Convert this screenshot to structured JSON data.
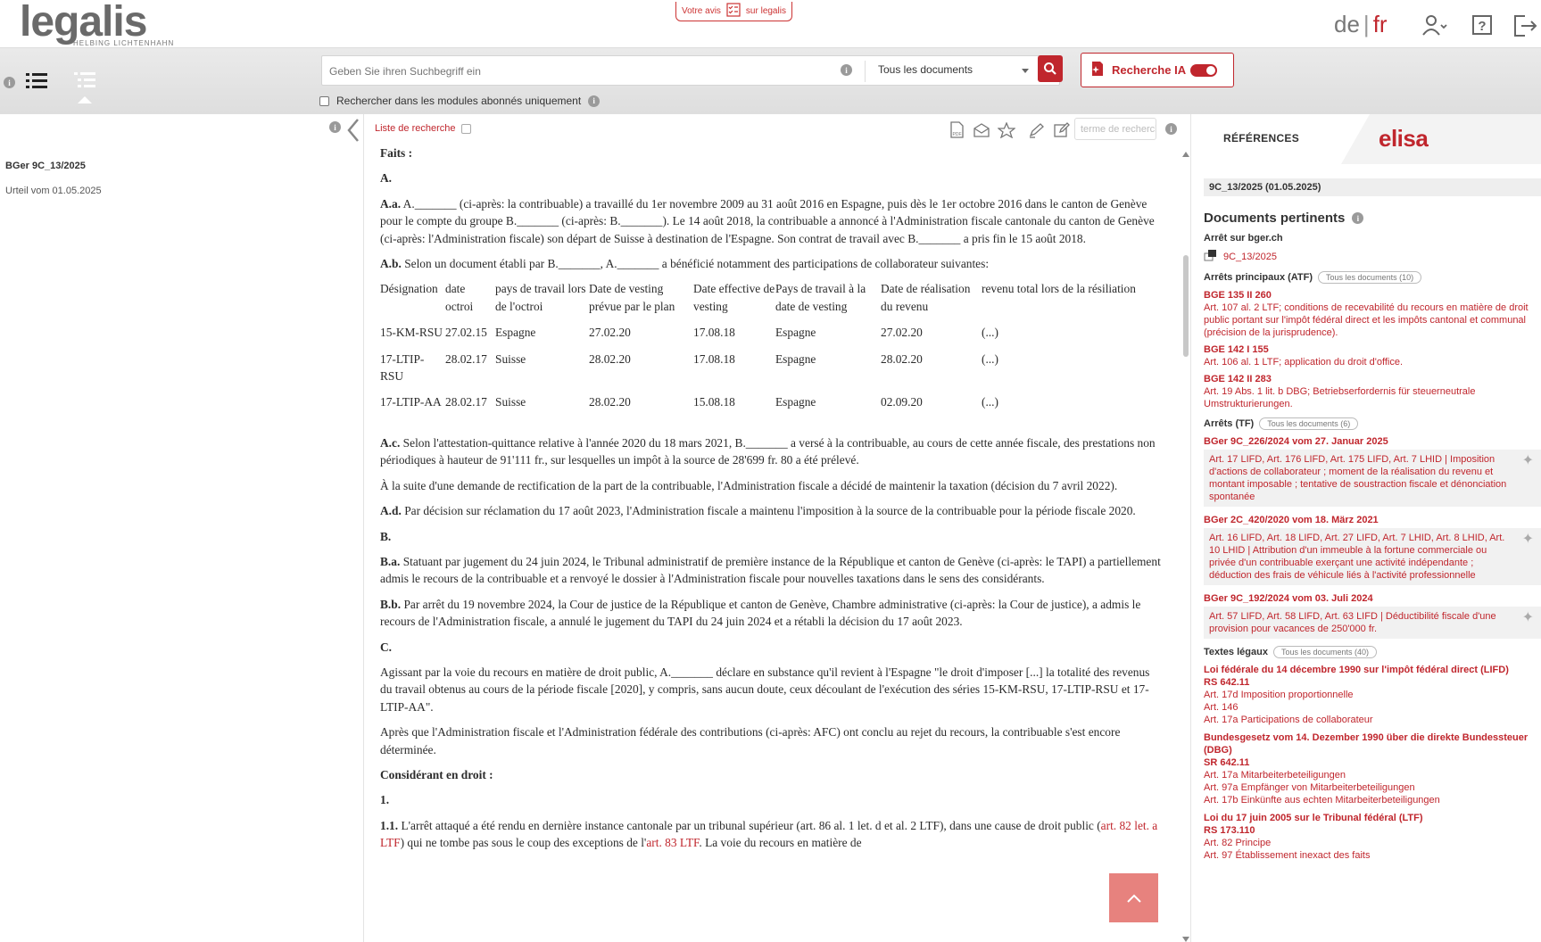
{
  "header": {
    "logo_main": "legalis",
    "logo_sub": "HELBING LICHTENHAHN",
    "feedback_left": "Votre avis",
    "feedback_right": "sur legalis",
    "lang_de": "de",
    "lang_sep": "|",
    "lang_fr": "fr"
  },
  "search": {
    "placeholder": "Geben Sie ihren Suchbegriff ein",
    "scope": "Tous les documents",
    "ai_label": "Recherche IA",
    "modules_label": "Rechercher dans les modules abonnés uniquement"
  },
  "left": {
    "title": "BGer 9C_13/2025",
    "subtitle": "Urteil vom 01.05.2025"
  },
  "toolbar": {
    "list_label": "Liste de recherche",
    "term_placeholder": "terme de recherche"
  },
  "doc": {
    "faits": "Faits :",
    "A": "A.",
    "Aa_num": "A.a.",
    "Aa": "A._______ (ci-après: la contribuable) a travaillé du 1er novembre 2009 au 31 août 2016 en Espagne, puis dès le 1er octobre 2016 dans le canton de Genève pour le compte du groupe B._______ (ci-après: B._______). Le 14 août 2018, la contribuable a annoncé à l'Administration fiscale cantonale du canton de Genève (ci-après: l'Administration fiscale) son départ de Suisse à destination de l'Espagne. Son contrat de travail avec B._______ a pris fin le 15 août 2018.",
    "Ab_num": "A.b.",
    "Ab": "Selon un document établi par B._______, A._______ a bénéficié notamment des participations de collaborateur suivantes:",
    "table_headers": [
      "Désignation",
      "date octroi",
      "pays de travail lors de l'octroi",
      "Date de vesting prévue par le plan",
      "Date effective de vesting",
      "Pays de travail à la date de vesting",
      "Date de réalisation du revenu",
      "revenu total lors de la résiliation"
    ],
    "table_rows": [
      [
        "15-KM-RSU",
        "27.02.15",
        "Espagne",
        "27.02.20",
        "17.08.18",
        "Espagne",
        "27.02.20",
        "(...)"
      ],
      [
        "17-LTIP-RSU",
        "28.02.17",
        "Suisse",
        "28.02.20",
        "17.08.18",
        "Espagne",
        "28.02.20",
        "(...)"
      ],
      [
        "17-LTIP-AA",
        "28.02.17",
        "Suisse",
        "28.02.20",
        "15.08.18",
        "Espagne",
        "02.09.20",
        "(...)"
      ]
    ],
    "Ac_num": "A.c.",
    "Ac": "Selon l'attestation-quittance relative à l'année 2020 du 18 mars 2021, B._______ a versé à la contribuable, au cours de cette année fiscale, des prestations non périodiques à hauteur de 91'111 fr., sur lesquelles un impôt à la source de 28'699 fr. 80 a été prélevé.",
    "Ac2": "À la suite d'une demande de rectification de la part de la contribuable, l'Administration fiscale a décidé de maintenir la taxation (décision du 7 avril 2022).",
    "Ad_num": "A.d.",
    "Ad": "Par décision sur réclamation du 17 août 2023, l'Administration fiscale a maintenu l'imposition à la source de la contribuable pour la période fiscale 2020.",
    "B": "B.",
    "Ba_num": "B.a.",
    "Ba": "Statuant par jugement du 24 juin 2024, le Tribunal administratif de première instance de la République et canton de Genève (ci-après: le TAPI) a partiellement admis le recours de la contribuable et a renvoyé le dossier à l'Administration fiscale pour nouvelles taxations dans le sens des considérants.",
    "Bb_num": "B.b.",
    "Bb": "Par arrêt du 19 novembre 2024, la Cour de justice de la République et canton de Genève, Chambre administrative (ci-après: la Cour de justice), a admis le recours de l'Administration fiscale, a annulé le jugement du TAPI du 24 juin 2024 et a rétabli la décision du 17 août 2023.",
    "C": "C.",
    "C1": "Agissant par la voie du recours en matière de droit public, A._______ déclare en substance qu'il revient à l'Espagne \"le droit d'imposer [...] la totalité des revenus du travail obtenus au cours de la période fiscale [2020], y compris, sans aucun doute, ceux découlant de l'exécution des séries 15-KM-RSU, 17-LTIP-RSU et 17-LTIP-AA\".",
    "C2": "Après que l'Administration fiscale et l'Administration fédérale des contributions (ci-après: AFC) ont conclu au rejet du recours, la contribuable s'est encore déterminée.",
    "considerant": "Considérant en droit :",
    "n1": "1.",
    "n11_num": "1.1.",
    "n11_a": "L'arrêt attaqué a été rendu en dernière instance cantonale par un tribunal supérieur (art. 86 al. 1 let. d et al. 2 LTF), dans une cause de droit public (",
    "n11_link1": "art. 82 let. a LTF",
    "n11_b": ") qui ne tombe pas sous le coup des exceptions de l'",
    "n11_link2": "art. 83 LTF",
    "n11_c": ". La voie du recours en matière de"
  },
  "right": {
    "tab_ref": "RÉFÉRENCES",
    "tab_elisa": "elisa",
    "case": "9C_13/2025 (01.05.2025)",
    "docs_title": "Documents pertinents",
    "bger_label": "Arrêt sur bger.ch",
    "bger_link": "9C_13/2025",
    "atf_label": "Arrêts principaux (ATF)",
    "atf_pill": "Tous les documents (10)",
    "atf": [
      {
        "title": "BGE 135 II 260",
        "text": "Art. 107 al. 2 LTF; conditions de recevabilité du recours en matière de droit public portant sur l'impôt fédéral direct et les impôts cantonal et communal (précision de la jurisprudence)."
      },
      {
        "title": "BGE 142 I 155",
        "text": "Art. 106 al. 1 LTF; application du droit d'office."
      },
      {
        "title": "BGE 142 II 283",
        "text": "Art. 19 Abs. 1 lit. b DBG; Betriebserfordernis für steuerneutrale Umstrukturierungen."
      }
    ],
    "tf_label": "Arrêts (TF)",
    "tf_pill": "Tous les documents (6)",
    "tf": [
      {
        "title": "BGer 9C_226/2024 vom 27. Januar 2025",
        "text": "Art. 17 LIFD, Art. 176 LIFD, Art. 175 LIFD, Art. 7 LHID | Imposition d'actions de collaborateur ; moment de la réalisation du revenu et montant imposable ; tentative de soustraction fiscale et dénonciation spontanée"
      },
      {
        "title": "BGer 2C_420/2020 vom 18. März 2021",
        "text": "Art. 16 LIFD, Art. 18 LIFD, Art. 27 LIFD, Art. 7 LHID, Art. 8 LHID, Art. 10 LHID | Attribution d'un immeuble à la fortune commerciale ou privée d'un contribuable exerçant une activité indépendante ; déduction des frais de véhicule liés à l'activité professionnelle"
      },
      {
        "title": "BGer 9C_192/2024 vom 03. Juli 2024",
        "text": "Art. 57 LIFD, Art. 58 LIFD, Art. 63 LIFD | Déductibilité fiscale d'une provision pour vacances de 250'000 fr."
      }
    ],
    "lois_label": "Textes légaux",
    "lois_pill": "Tous les documents (40)",
    "lois": [
      {
        "title": "Loi fédérale du 14 décembre 1990 sur l'impôt fédéral direct (LIFD)",
        "rs": "RS 642.11",
        "items": [
          "Art. 17d Imposition proportionnelle",
          "Art. 146",
          "Art. 17a Participations de collaborateur"
        ]
      },
      {
        "title": "Bundesgesetz vom 14. Dezember 1990 über die direkte Bundessteuer (DBG)",
        "rs": "SR 642.11",
        "items": [
          "Art. 17a Mitarbeiterbeteiligungen",
          "Art. 97a Empfänger von Mitarbeiterbeteiligungen",
          "Art. 17b Einkünfte aus echten Mitarbeiterbeteiligungen"
        ]
      },
      {
        "title": "Loi du 17 juin 2005 sur le Tribunal fédéral (LTF)",
        "rs": "RS 173.110",
        "items": [
          "Art. 82 Principe",
          "Art. 97 Établissement inexact des faits"
        ]
      }
    ]
  },
  "colors": {
    "accent": "#c0262d",
    "back_top": "#e7827e"
  }
}
